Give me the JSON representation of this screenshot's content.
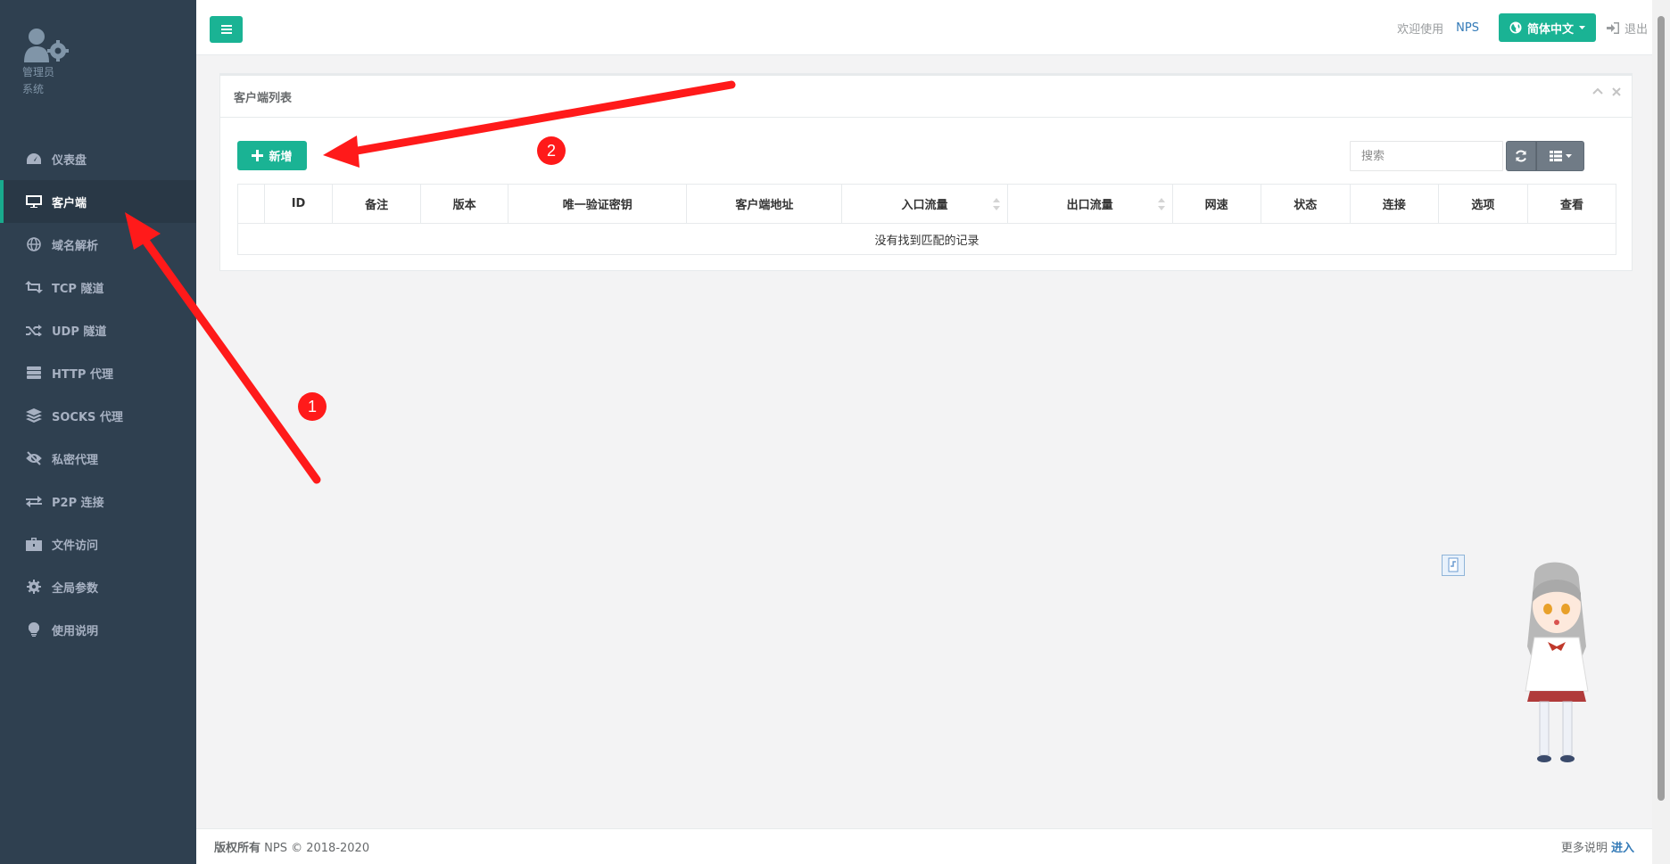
{
  "sidebar": {
    "user_name": "管理员",
    "user_role": "系统",
    "items": [
      {
        "label": "仪表盘",
        "icon": "dashboard-icon"
      },
      {
        "label": "客户端",
        "icon": "monitor-icon",
        "active": true
      },
      {
        "label": "域名解析",
        "icon": "globe-icon"
      },
      {
        "label": "TCP 隧道",
        "icon": "retweet-icon"
      },
      {
        "label": "UDP 隧道",
        "icon": "random-icon"
      },
      {
        "label": "HTTP 代理",
        "icon": "server-icon"
      },
      {
        "label": "SOCKS 代理",
        "icon": "layers-icon"
      },
      {
        "label": "私密代理",
        "icon": "eye-slash-icon"
      },
      {
        "label": "P2P 连接",
        "icon": "exchange-icon"
      },
      {
        "label": "文件访问",
        "icon": "briefcase-icon"
      },
      {
        "label": "全局参数",
        "icon": "gear-icon"
      },
      {
        "label": "使用说明",
        "icon": "lightbulb-icon"
      }
    ]
  },
  "header": {
    "welcome": "欢迎使用",
    "brand_link": "NPS",
    "language": "简体中文",
    "logout": "退出"
  },
  "panel": {
    "title": "客户端列表",
    "add_label": "新增",
    "search_placeholder": "搜索",
    "columns": [
      "ID",
      "备注",
      "版本",
      "唯一验证密钥",
      "客户端地址",
      "入口流量",
      "出口流量",
      "网速",
      "状态",
      "连接",
      "选项",
      "查看"
    ],
    "empty_message": "没有找到匹配的记录"
  },
  "footer": {
    "copyright_bold": "版权所有",
    "copyright_rest": "NPS © 2018-2020",
    "more_text": "更多说明",
    "more_link": "进入"
  },
  "annotations": {
    "marker_1": "1",
    "marker_2": "2",
    "arrow_color": "#ff1a1a"
  },
  "colors": {
    "sidebar_bg": "#2f4050",
    "accent": "#1ab394",
    "link": "#337ab7"
  }
}
